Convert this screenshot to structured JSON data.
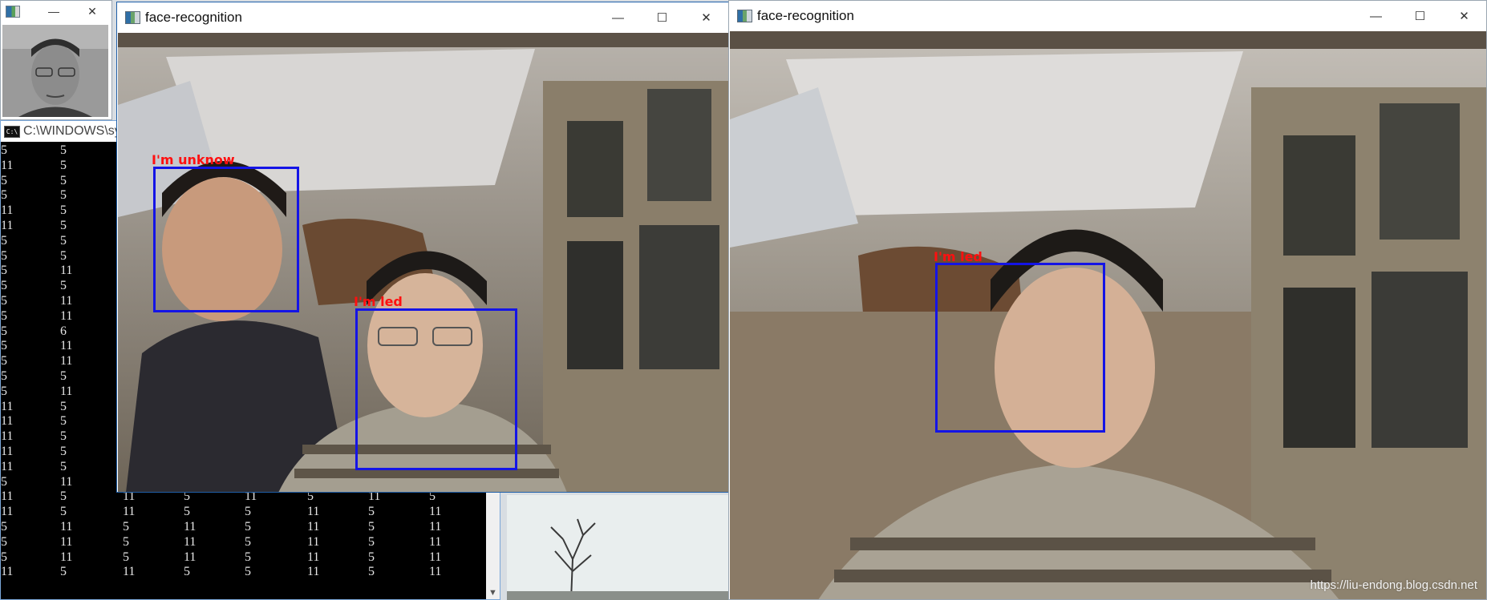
{
  "small_window": {
    "minimize_glyph": "—",
    "maximize_glyph": "☐",
    "close_glyph": "✕"
  },
  "console": {
    "title": "C:\\WINDOWS\\sys",
    "rows": [
      [
        "5",
        "5"
      ],
      [
        "11",
        "5"
      ],
      [
        "5",
        "5"
      ],
      [
        "5",
        "5"
      ],
      [
        "11",
        "5"
      ],
      [
        "11",
        "5"
      ],
      [
        "5",
        "5"
      ],
      [
        "5",
        "5"
      ],
      [
        "5",
        "11"
      ],
      [
        "5",
        "5"
      ],
      [
        "5",
        "11"
      ],
      [
        "5",
        "11"
      ],
      [
        "5",
        "6"
      ],
      [
        "5",
        "11"
      ],
      [
        "5",
        "11"
      ],
      [
        "5",
        "5"
      ],
      [
        "5",
        "11"
      ],
      [
        "11",
        "5"
      ],
      [
        "11",
        "5"
      ],
      [
        "11",
        "5"
      ],
      [
        "11",
        "5"
      ],
      [
        "11",
        "5"
      ],
      [
        "5",
        "11"
      ],
      [
        "11",
        "5",
        "11",
        "5",
        "11",
        "5",
        "11",
        "5"
      ],
      [
        "11",
        "5",
        "11",
        "5",
        "5",
        "11",
        "5",
        "11"
      ],
      [
        "5",
        "11",
        "5",
        "11",
        "5",
        "11",
        "5",
        "11"
      ],
      [
        "5",
        "11",
        "5",
        "11",
        "5",
        "11",
        "5",
        "11"
      ],
      [
        "5",
        "11",
        "5",
        "11",
        "5",
        "11",
        "5",
        "11"
      ],
      [
        "11",
        "5",
        "11",
        "5",
        "5",
        "11",
        "5",
        "11"
      ]
    ]
  },
  "window_left": {
    "title": "face-recognition",
    "minimize_glyph": "—",
    "maximize_glyph": "☐",
    "close_glyph": "✕",
    "faces": [
      {
        "label": "I'm unknow"
      },
      {
        "label": "I'm led"
      }
    ]
  },
  "window_right": {
    "title": "face-recognition",
    "minimize_glyph": "—",
    "maximize_glyph": "☐",
    "close_glyph": "✕",
    "faces": [
      {
        "label": "I'm led"
      }
    ],
    "watermark": "https://liu-endong.blog.csdn.net"
  },
  "colors": {
    "face_box": "#1414e6",
    "face_label": "#ff1010",
    "console_bg": "#000000",
    "console_text": "#e6e6e6"
  }
}
